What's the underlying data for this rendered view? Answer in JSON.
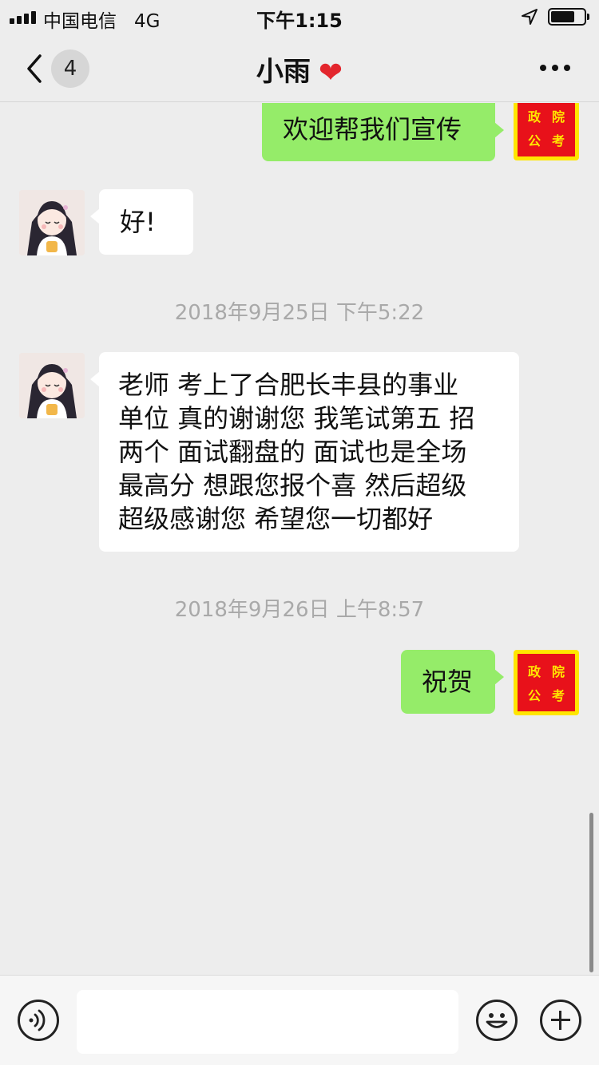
{
  "status_bar": {
    "carrier": "中国电信",
    "network": "4G",
    "time": "下午1:15"
  },
  "nav": {
    "back_icon": "chevron-left-icon",
    "unread_count": "4",
    "title": "小雨",
    "title_emoji": "❤",
    "more_icon": "more-dots-icon"
  },
  "self_avatar": {
    "seal_chars": [
      "政",
      "院",
      "公",
      "考"
    ],
    "colors": {
      "frame": "#ffe600",
      "seal": "#e8111a"
    }
  },
  "messages": [
    {
      "sender": "self",
      "text": "欢迎帮我们宣传"
    },
    {
      "sender": "peer",
      "text": "好!"
    },
    {
      "type": "timestamp",
      "text": "2018年9月25日 下午5:22"
    },
    {
      "sender": "peer",
      "lines": [
        "老师 考上了合肥长丰县的事业",
        "单位 真的谢谢您 我笔试第五 招",
        "两个 面试翻盘的 面试也是全场",
        "最高分 想跟您报个喜 然后超级",
        "超级感谢您 希望您一切都好"
      ]
    },
    {
      "type": "timestamp",
      "text": "2018年9月26日 上午8:57"
    },
    {
      "sender": "self",
      "text": "祝贺"
    }
  ],
  "input_bar": {
    "voice_icon": "voice-icon",
    "input_value": "",
    "emoji_icon": "emoji-icon",
    "plus_icon": "plus-icon"
  },
  "colors": {
    "background": "#ededed",
    "bubble_out": "#95ec69",
    "bubble_in": "#ffffff",
    "timestamp": "#a9a9a9"
  }
}
